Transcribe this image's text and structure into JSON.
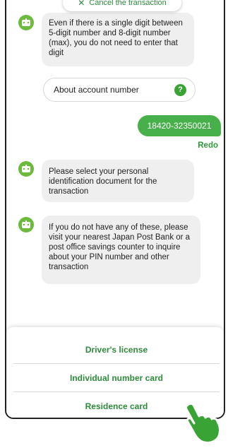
{
  "cancel": {
    "label": "Cancel the transaction",
    "icon": "close-icon"
  },
  "messages": {
    "m1": "Even if there is a single digit between 5-digit number and 8-digit number (max), you do not need to enter that digit",
    "account_button": "About account number",
    "help_symbol": "?",
    "user_reply": "18420-32350021",
    "redo": "Redo",
    "m2": "Please select your personal identification document for the transaction",
    "m3": "If you do not have any of these, please visit your nearest Japan Post Bank or a post office savings counter to inquire about your PIN number and other transaction"
  },
  "options": [
    "Driver's license",
    "Individual number card",
    "Residence card"
  ],
  "colors": {
    "accent": "#47b04b",
    "accent_text": "#2e8b3a",
    "avatar": "#6cbb3c",
    "bubble": "#efefef",
    "hand": "#3aa335"
  },
  "icons": {
    "bot": "robot-avatar-icon",
    "pointer": "pointing-hand-icon"
  }
}
